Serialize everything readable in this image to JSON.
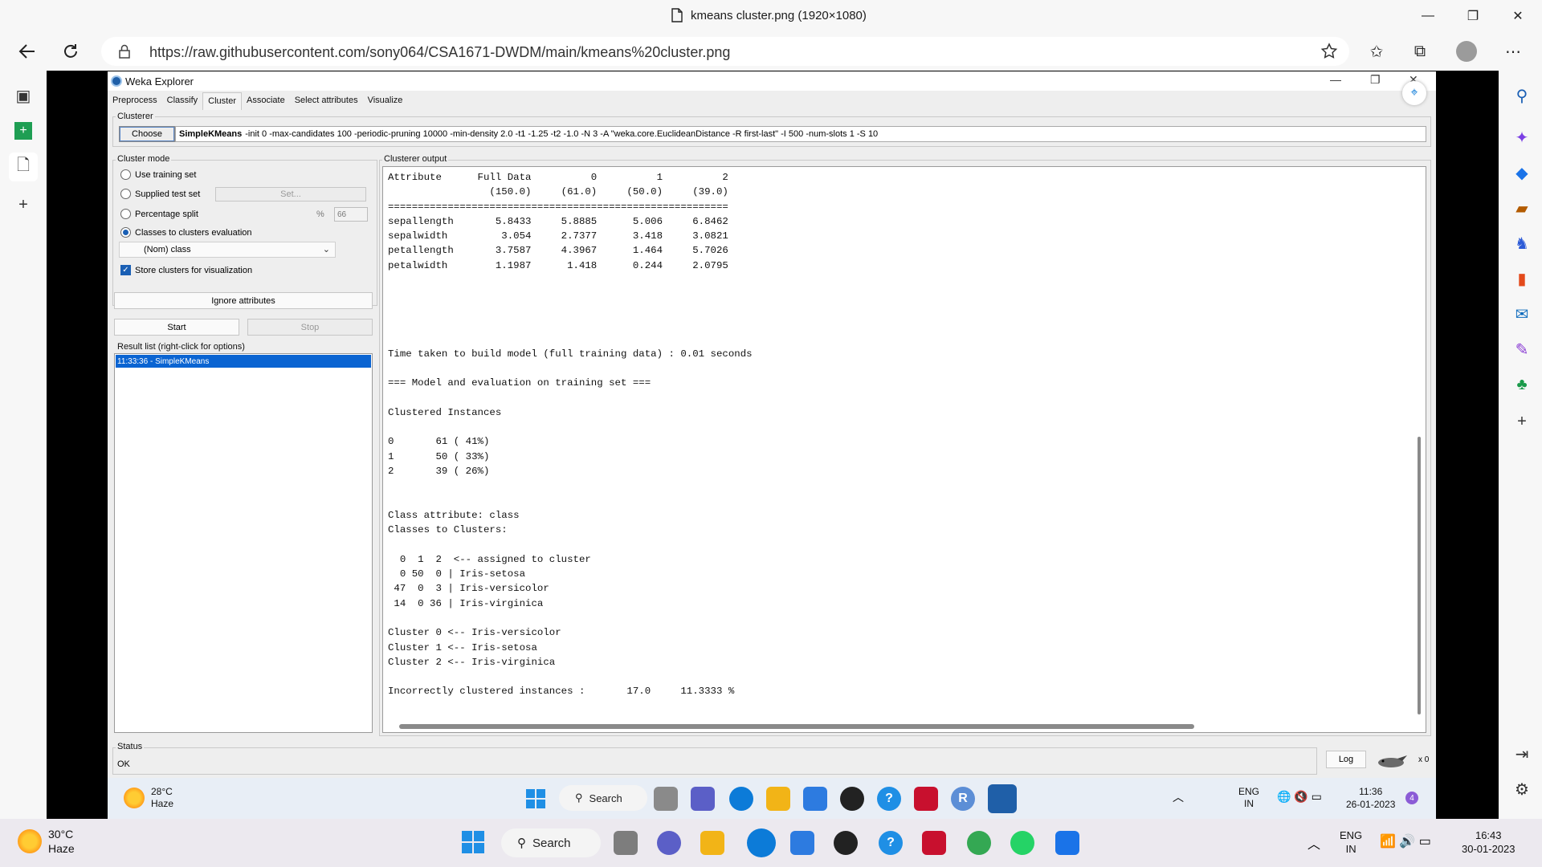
{
  "browser": {
    "doc_title": "kmeans cluster.png (1920×1080)",
    "url": "https://raw.githubusercontent.com/sony064/CSA1671-DWDM/main/kmeans%20cluster.png"
  },
  "weka": {
    "window_title": "Weka Explorer",
    "tabs": [
      "Preprocess",
      "Classify",
      "Cluster",
      "Associate",
      "Select attributes",
      "Visualize"
    ],
    "clusterer_label": "Clusterer",
    "choose_label": "Choose",
    "clusterer_name": "SimpleKMeans",
    "clusterer_options": "-init 0 -max-candidates 100 -periodic-pruning 10000 -min-density 2.0 -t1 -1.25 -t2 -1.0 -N 3 -A \"weka.core.EuclideanDistance -R first-last\" -I 500 -num-slots 1 -S 10",
    "cluster_mode_label": "Cluster mode",
    "modes": {
      "use_training": "Use training set",
      "supplied_test": "Supplied test set",
      "set_btn": "Set...",
      "percentage_split": "Percentage split",
      "percent_sign": "%",
      "percent_value": "66",
      "classes_to_clusters": "Classes to clusters evaluation",
      "class_select": "(Nom) class",
      "store_clusters": "Store clusters for visualization"
    },
    "ignore_btn": "Ignore attributes",
    "start_btn": "Start",
    "stop_btn": "Stop",
    "result_list_label": "Result list (right-click for options)",
    "result_item": "11:33:36 - SimpleKMeans",
    "output_label": "Clusterer output",
    "output_text": "Attribute      Full Data          0          1          2\n                 (150.0)     (61.0)     (50.0)     (39.0)\n=========================================================\nsepallength       5.8433     5.8885      5.006     6.8462\nsepalwidth         3.054     2.7377      3.418     3.0821\npetallength       3.7587     4.3967      1.464     5.7026\npetalwidth        1.1987      1.418      0.244     2.0795\n\n\n\n\n\nTime taken to build model (full training data) : 0.01 seconds\n\n=== Model and evaluation on training set ===\n\nClustered Instances\n\n0       61 ( 41%)\n1       50 ( 33%)\n2       39 ( 26%)\n\n\nClass attribute: class\nClasses to Clusters:\n\n  0  1  2  <-- assigned to cluster\n  0 50  0 | Iris-setosa\n 47  0  3 | Iris-versicolor\n 14  0 36 | Iris-virginica\n\nCluster 0 <-- Iris-versicolor\nCluster 1 <-- Iris-setosa\nCluster 2 <-- Iris-virginica\n\nIncorrectly clustered instances :       17.0     11.3333 %",
    "status_label": "Status",
    "status_value": "OK",
    "log_btn": "Log",
    "x_count": "x 0"
  },
  "inner_taskbar": {
    "temp": "28°C",
    "condition": "Haze",
    "search": "Search",
    "lang_top": "ENG",
    "lang_bottom": "IN",
    "time": "11:36",
    "date": "26-01-2023",
    "badge": "4"
  },
  "taskbar": {
    "temp": "30°C",
    "condition": "Haze",
    "search": "Search",
    "lang_top": "ENG",
    "lang_bottom": "IN",
    "time": "16:43",
    "date": "30-01-2023"
  },
  "colors": {
    "selection": "#0a64d2",
    "edge_accent": "#0c7bd8"
  }
}
